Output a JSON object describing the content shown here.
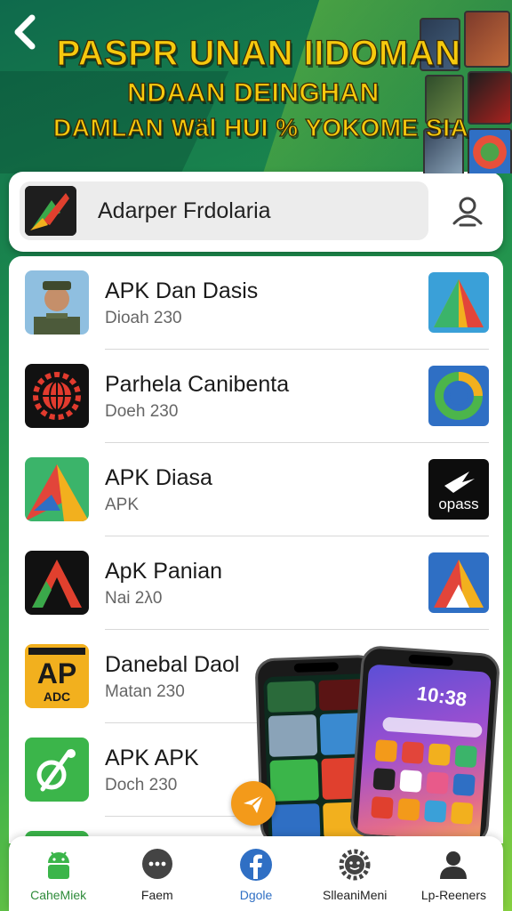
{
  "banner": {
    "line1": "PASPR UNAN IIDOMAN",
    "line2": "NDAAN DEINGHAN",
    "line3": "DAMLAN Wäl HUI % YOKOME SIA"
  },
  "search": {
    "value": "Adarper Frdolaria"
  },
  "list": [
    {
      "title": "APK Dan Dasis",
      "subtitle": "Dioah 230",
      "icon": "soldier-avatar-icon",
      "side_icon": "triangle-logo-icon"
    },
    {
      "title": "Parhela Canibenta",
      "subtitle": "Doeh 230",
      "icon": "red-globe-gear-icon",
      "side_icon": "green-ring-logo-icon"
    },
    {
      "title": "APK Diasa",
      "subtitle": "APK",
      "icon": "color-triangle-icon",
      "side_icon": "opass-logo-icon",
      "side_text": "opass"
    },
    {
      "title": "ApK Panian",
      "subtitle": "Nai 2λ0",
      "icon": "dark-arrow-icon",
      "side_icon": "triangle-logo-icon"
    },
    {
      "title": "Danebal Daol",
      "subtitle": "Matan 230",
      "icon": "ap-adc-badge-icon",
      "icon_text_top": "AP",
      "icon_text_bottom": "ADC"
    },
    {
      "title": "APK APK",
      "subtitle": "Doch 230",
      "icon": "green-leaf-icon"
    }
  ],
  "phones": {
    "clock": "10:38"
  },
  "nav": [
    {
      "label": "CaheMiek",
      "icon": "android-icon"
    },
    {
      "label": "Faem",
      "icon": "chat-bubble-icon"
    },
    {
      "label": "Dgole",
      "icon": "facebook-icon"
    },
    {
      "label": "SlleaniMeni",
      "icon": "gear-face-icon"
    },
    {
      "label": "Lp-Reeners",
      "icon": "person-icon"
    }
  ],
  "colors": {
    "accent_green": "#2e8b3a",
    "banner_text": "#f6c90e",
    "fab": "#f39a1a"
  }
}
